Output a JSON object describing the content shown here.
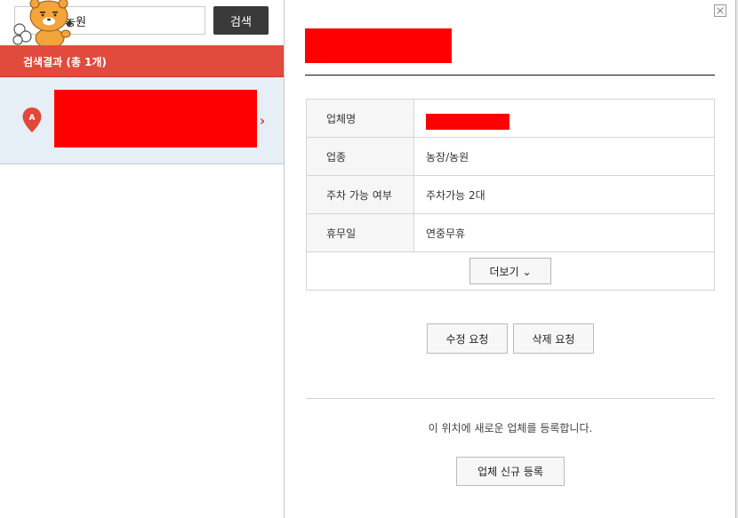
{
  "search": {
    "query": "농원",
    "button_label": "검색"
  },
  "results": {
    "header": "검색결과 (총 1개)",
    "items": [
      {
        "marker_label": "A"
      }
    ]
  },
  "detail": {
    "rows": [
      {
        "label": "업체명",
        "value": ""
      },
      {
        "label": "업종",
        "value": "농장/농원"
      },
      {
        "label": "주차 가능 여부",
        "value": "주차가능 2대"
      },
      {
        "label": "휴무일",
        "value": "연중무휴"
      }
    ],
    "more_label": "더보기",
    "edit_label": "수정 요청",
    "delete_label": "삭제 요청",
    "register_text": "이 위치에 새로운 업체를 등록합니다.",
    "register_label": "업체 신규 등록"
  },
  "colors": {
    "header_red": "#e04b3d",
    "result_bg": "#e6eef6",
    "redaction": "#ff0000"
  },
  "icons": [
    "mascot-icon",
    "map-pin-icon",
    "chevron-right-icon",
    "close-icon",
    "chevron-down-icon"
  ]
}
